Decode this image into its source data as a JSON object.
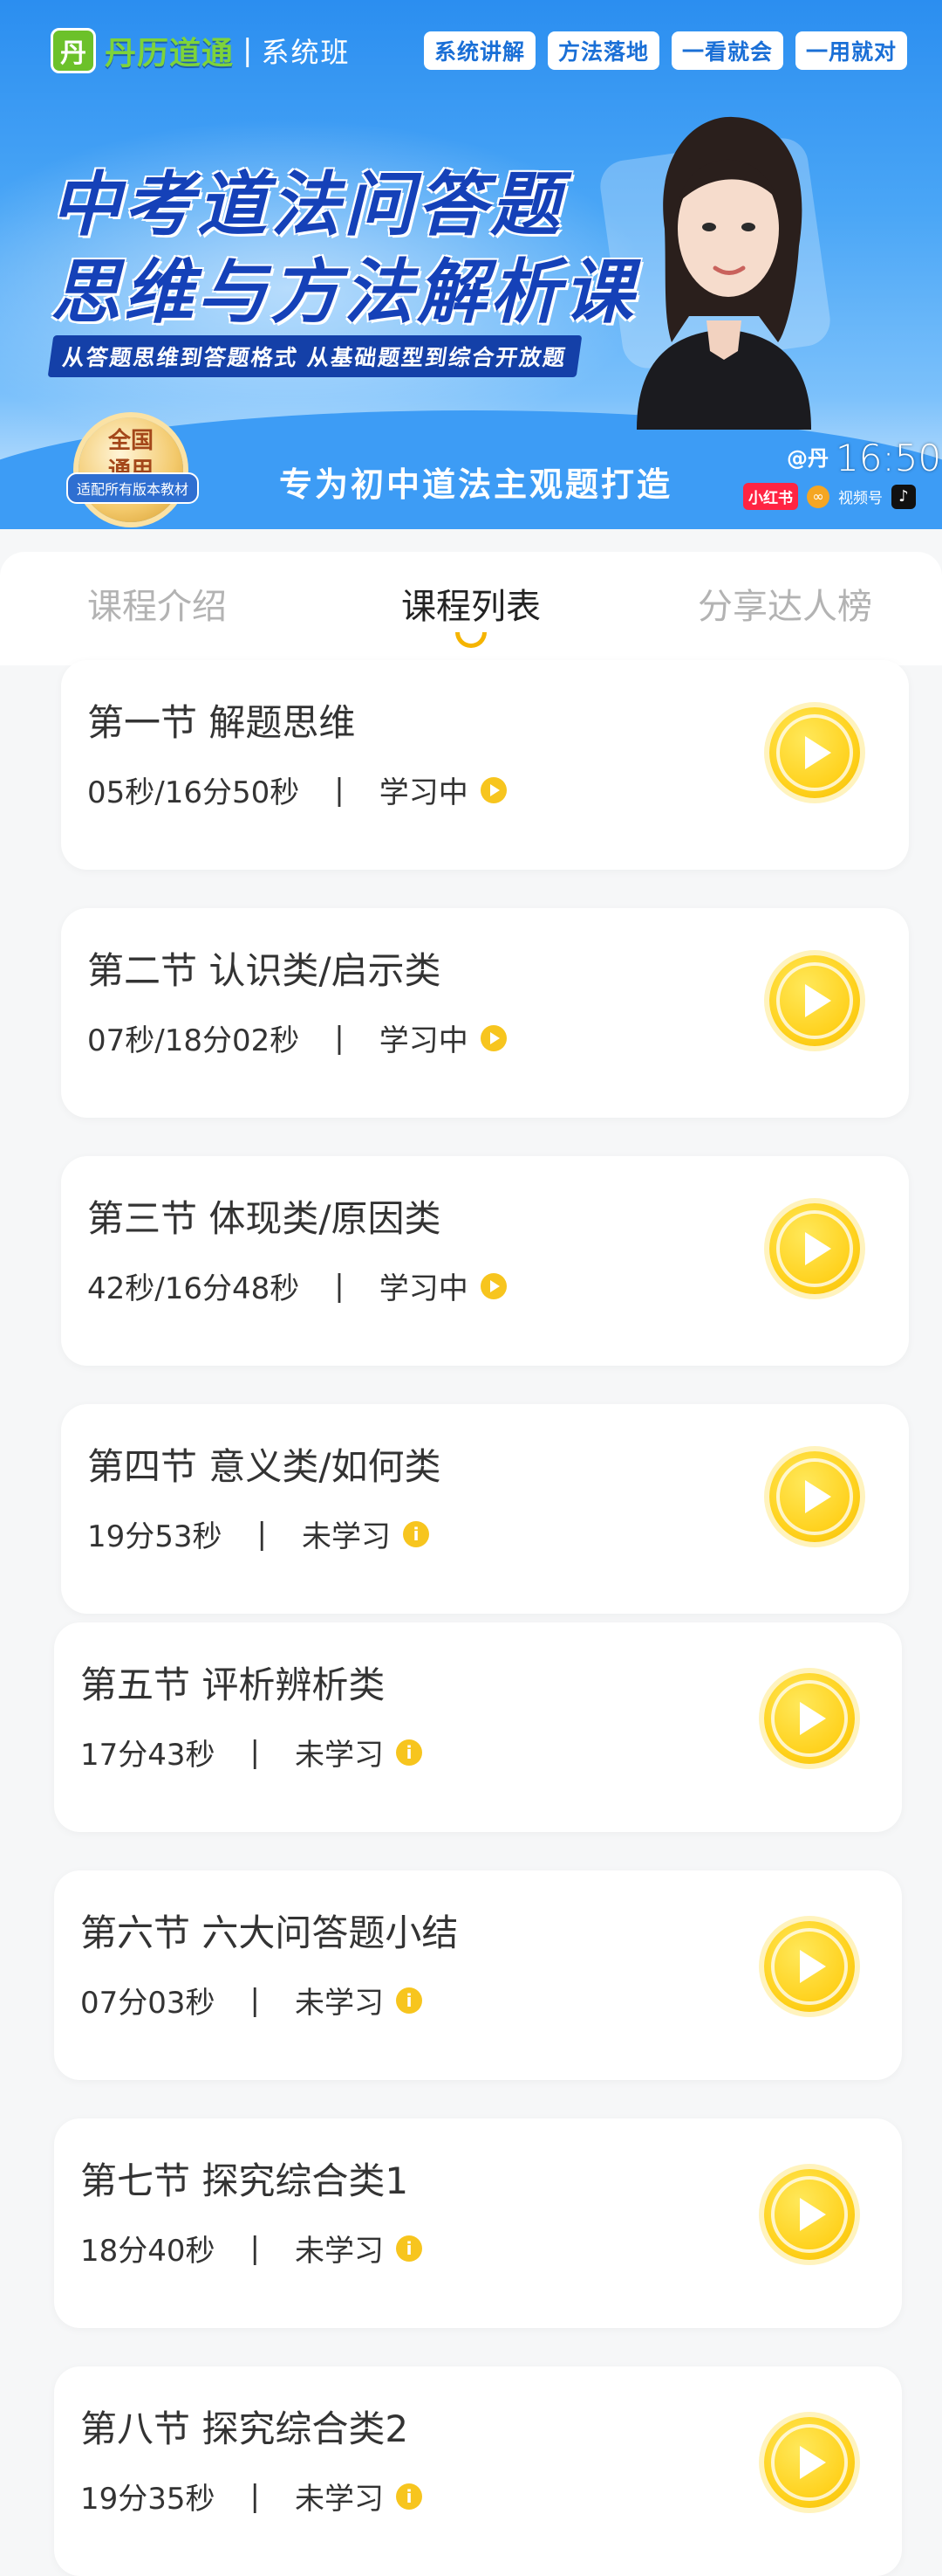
{
  "banner": {
    "logo_mark": "丹",
    "logo_text": "丹历道通",
    "logo_sep": "|",
    "logo_sub": "系统班",
    "tags": [
      "系统讲解",
      "方法落地",
      "一看就会",
      "一用就对"
    ],
    "title_line1": "中考道法问答题",
    "title_line2": "思维与方法解析课",
    "subline": "从答题思维到答题格式  从基础题型到综合开放题",
    "seal_line1": "全国",
    "seal_line2": "通用",
    "seal_ribbon": "适配所有版本教材",
    "slogan": "专为初中道法主观题打造",
    "handle": "@丹",
    "clock": "16:50",
    "platform_red": "小红书",
    "platform_video": "视频号"
  },
  "tabs": [
    {
      "label": "课程介绍",
      "active": false
    },
    {
      "label": "课程列表",
      "active": true
    },
    {
      "label": "分享达人榜",
      "active": false
    }
  ],
  "lessons": [
    {
      "title": "第一节 解题思维",
      "duration": "05秒/16分50秒",
      "status": "学习中",
      "status_type": "learning"
    },
    {
      "title": "第二节 认识类/启示类",
      "duration": "07秒/18分02秒",
      "status": "学习中",
      "status_type": "learning"
    },
    {
      "title": "第三节 体现类/原因类",
      "duration": "42秒/16分48秒",
      "status": "学习中",
      "status_type": "learning"
    },
    {
      "title": "第四节 意义类/如何类",
      "duration": "19分53秒",
      "status": "未学习",
      "status_type": "new"
    },
    {
      "title": "第五节 评析辨析类",
      "duration": "17分43秒",
      "status": "未学习",
      "status_type": "new"
    },
    {
      "title": "第六节 六大问答题小结",
      "duration": "07分03秒",
      "status": "未学习",
      "status_type": "new"
    },
    {
      "title": "第七节 探究综合类1",
      "duration": "18分40秒",
      "status": "未学习",
      "status_type": "new"
    },
    {
      "title": "第八节 探究综合类2",
      "duration": "19分35秒",
      "status": "未学习",
      "status_type": "new"
    }
  ],
  "separator": "|",
  "colors": {
    "accent": "#f7c51e",
    "banner_blue": "#2b8ef0",
    "title_blue": "#1541b8"
  }
}
